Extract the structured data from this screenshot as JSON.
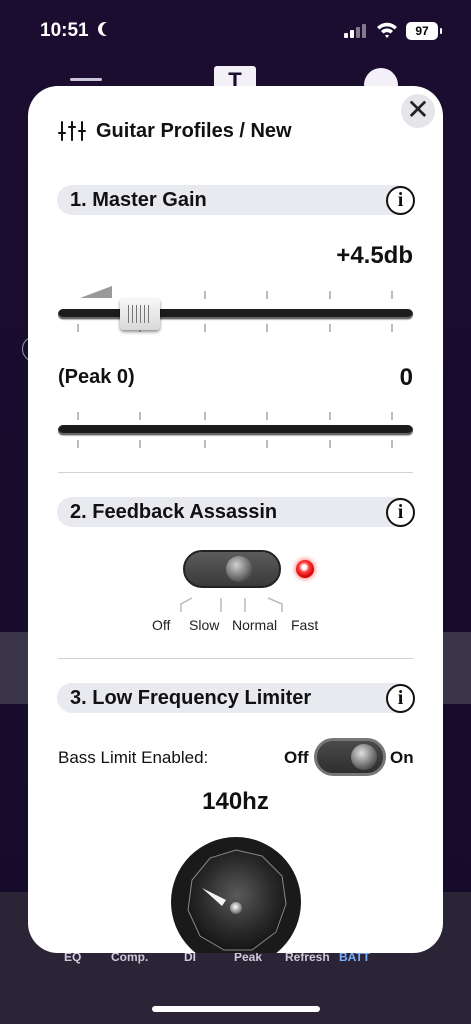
{
  "status_bar": {
    "time": "10:51",
    "battery": "97"
  },
  "background_app": {
    "logo": "T",
    "tabs": [
      "EQ",
      "Comp.",
      "DI",
      "Peak",
      "Refresh",
      "BATT"
    ]
  },
  "modal": {
    "title": "Guitar Profiles / New",
    "close_label": "✕",
    "sections": [
      {
        "label": "1.  Master Gain"
      },
      {
        "label": "2.  Feedback Assassin"
      },
      {
        "label": "3.  Low Frequency Limiter"
      }
    ],
    "info_label": "i",
    "master_gain": {
      "value": "+4.5db",
      "slider_position_fraction": 0.2
    },
    "peak": {
      "label": "(Peak 0)",
      "value": "0"
    },
    "feedback_assassin": {
      "modes": [
        "Off",
        "Slow",
        "Normal",
        "Fast"
      ],
      "led_color": "#ff2a2a"
    },
    "low_frequency_limiter": {
      "bass_limit_label": "Bass Limit Enabled:",
      "off_label": "Off",
      "on_label": "On",
      "frequency": "140hz"
    }
  },
  "colors": {
    "background": "#1c0f33",
    "section_bar": "#e8eaef",
    "accent_batt": "#7db0ff"
  }
}
